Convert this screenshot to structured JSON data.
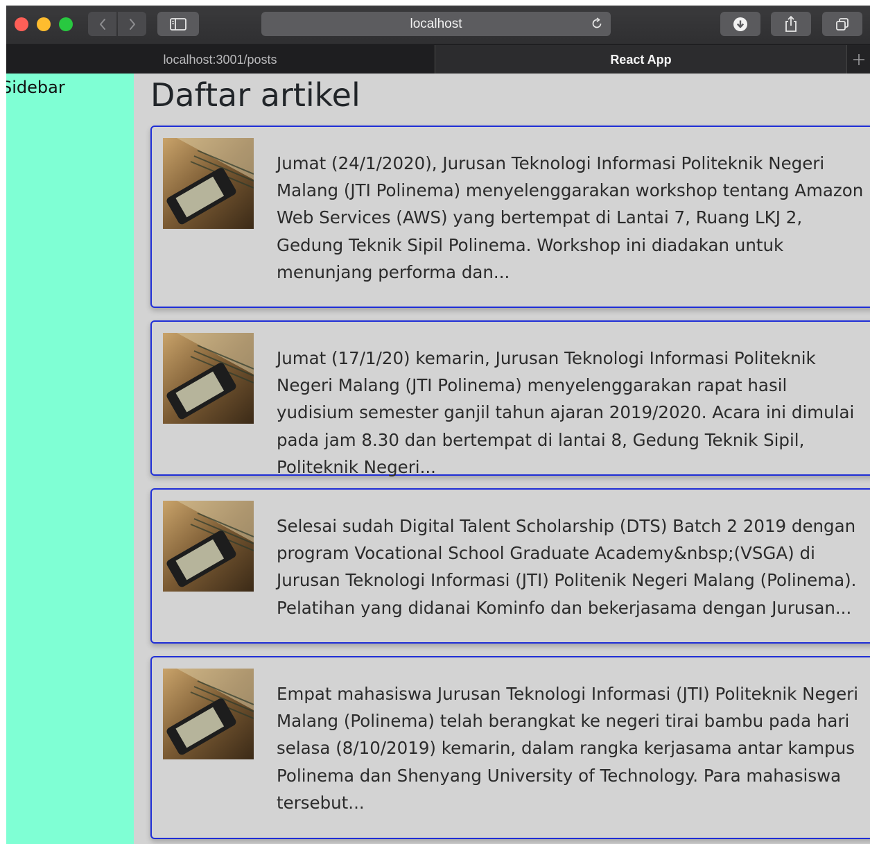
{
  "browser": {
    "address": "localhost",
    "tabs": [
      {
        "label": "localhost:3001/posts"
      },
      {
        "label": "React App"
      }
    ]
  },
  "sidebar": {
    "label": "Sidebar"
  },
  "main": {
    "title": "Daftar artikel",
    "posts": [
      {
        "excerpt": "Jumat (24/1/2020), Jurusan Teknologi Informasi Politeknik Negeri Malang (JTI Polinema) menyelenggarakan workshop tentang Amazon Web Services (AWS) yang bertempat di Lantai 7, Ruang LKJ 2, Gedung Teknik Sipil Polinema. Workshop ini diadakan untuk menunjang performa dan..."
      },
      {
        "excerpt": "Jumat (17/1/20) kemarin, Jurusan Teknologi Informasi Politeknik Negeri Malang (JTI Polinema) menyelenggarakan rapat hasil yudisium semester ganjil tahun ajaran 2019/2020. Acara ini dimulai pada jam 8.30 dan bertempat di lantai 8, Gedung Teknik Sipil, Politeknik Negeri..."
      },
      {
        "excerpt": "Selesai sudah Digital Talent Scholarship (DTS) Batch 2 2019 dengan program Vocational School Graduate Academy&nbsp;(VSGA) di Jurusan Teknologi Informasi (JTI) Politenik Negeri Malang (Polinema). Pelatihan yang didanai Kominfo dan bekerjasama dengan Jurusan..."
      },
      {
        "excerpt": "Empat mahasiswa Jurusan Teknologi Informasi (JTI) Politeknik Negeri Malang (Polinema) telah berangkat ke negeri tirai bambu pada hari selasa (8/10/2019) kemarin, dalam rangka kerjasama antar kampus Polinema dan Shenyang University of Technology. Para mahasiswa tersebut..."
      }
    ]
  },
  "colors": {
    "sidebar_bg": "#7fffd4",
    "card_border": "#1f2ed6",
    "page_bg": "#d3d3d3"
  },
  "icons": [
    "back-icon",
    "forward-icon",
    "sidebar-toggle-icon",
    "reload-icon",
    "download-icon",
    "share-icon",
    "tabs-overview-icon",
    "new-tab-icon",
    "post-thumbnail-phone-keyboard"
  ]
}
